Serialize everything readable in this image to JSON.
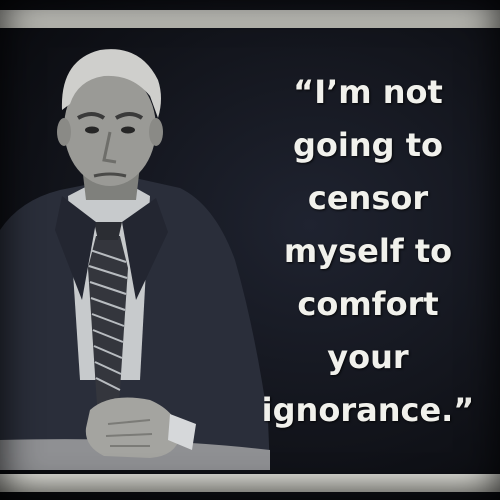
{
  "quote": {
    "lines": [
      "“I’m not",
      "going to",
      "censor",
      "myself to",
      "comfort",
      "your",
      "ignorance.”"
    ]
  },
  "colors": {
    "background": "#12141b",
    "border_bar": "#c9c9c2",
    "text": "#f1f1ec",
    "suit": "#2a2e3a",
    "shirt": "#cfd2d4",
    "skin": "#9a9a96"
  }
}
